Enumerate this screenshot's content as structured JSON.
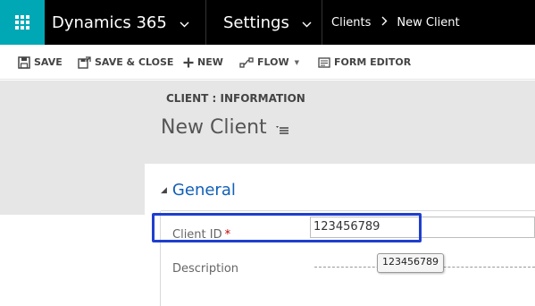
{
  "topbar": {
    "app_name": "Dynamics 365",
    "area": "Settings",
    "breadcrumb": {
      "parent": "Clients",
      "current": "New Client"
    },
    "waffle_color": "#00a8b5"
  },
  "commands": {
    "save": "SAVE",
    "save_close": "SAVE & CLOSE",
    "new": "NEW",
    "flow": "FLOW",
    "form_editor": "FORM EDITOR"
  },
  "header": {
    "entity_label": "CLIENT : INFORMATION",
    "record_title": "New Client"
  },
  "form": {
    "section_title": "General",
    "fields": {
      "client_id": {
        "label": "Client ID",
        "required_marker": "*",
        "value": "123456789"
      },
      "description": {
        "label": "Description",
        "value": ""
      }
    },
    "tooltip": "123456789",
    "highlight_color": "#1f3fcf"
  }
}
